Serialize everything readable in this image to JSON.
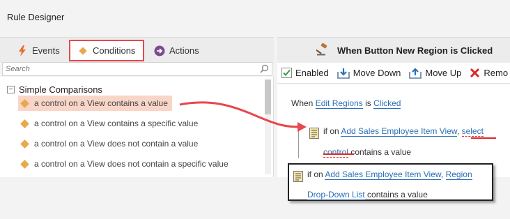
{
  "window": {
    "title": "Rule Designer"
  },
  "tabs": {
    "events": "Events",
    "conditions": "Conditions",
    "actions": "Actions"
  },
  "search": {
    "placeholder": "Search"
  },
  "tree": {
    "group": "Simple Comparisons",
    "items": [
      "a control on a View contains a value",
      "a control on a View contains a specific value",
      "a control on a View does not contain a value",
      "a control on a View does not contain a specific value"
    ]
  },
  "rule_panel": {
    "heading": "When Button New Region is Clicked",
    "toolbar": {
      "enabled": "Enabled",
      "move_down": "Move Down",
      "move_up": "Move Up",
      "remove": "Remo"
    },
    "when": {
      "prefix": "When",
      "control": "Edit Regions",
      "is": "is",
      "event": "Clicked"
    },
    "condition": {
      "if_on": "if on",
      "view": "Add Sales Employee Item View",
      "comma": ",",
      "control": "select control",
      "suffix": "contains a value"
    },
    "callout": {
      "if_on": "if on",
      "view": "Add Sales Employee Item View",
      "comma": ",",
      "control": "Region Drop-Down List",
      "suffix": "contains a value"
    }
  },
  "colors": {
    "highlight_border": "#e8474b",
    "link": "#2d6fb5",
    "selected_row": "#f9d5c8",
    "diamond": "#e9a94a",
    "arrow": "#e8474b"
  },
  "icons": {
    "events": "lightning-icon",
    "conditions": "diamond-icon",
    "actions": "arrow-circle-icon",
    "heading": "gavel-icon",
    "search": "search-icon"
  }
}
